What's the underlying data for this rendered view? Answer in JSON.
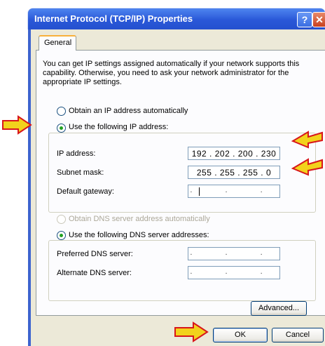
{
  "window": {
    "title": "Internet Protocol (TCP/IP) Properties",
    "help_icon": "question-mark",
    "close_icon": "x"
  },
  "tabs": [
    {
      "label": "General",
      "selected": true
    }
  ],
  "intro_text": "You can get IP settings assigned automatically if your network supports this capability. Otherwise, you need to ask your network administrator for the appropriate IP settings.",
  "ip_settings": {
    "auto_option": {
      "label": "Obtain an IP address automatically",
      "selected": false
    },
    "manual_option": {
      "label": "Use the following IP address:",
      "selected": true
    },
    "fields": [
      {
        "label": "IP address:",
        "value": "192 . 202 . 200 . 230"
      },
      {
        "label": "Subnet mask:",
        "value": "255 . 255 . 255 .   0"
      },
      {
        "label": "Default gateway:",
        "value": "",
        "placeholder_dots": ". . ."
      }
    ]
  },
  "dns_settings": {
    "auto_option": {
      "label": "Obtain DNS server address automatically",
      "selected": false,
      "disabled": true
    },
    "manual_option": {
      "label": "Use the following DNS server addresses:",
      "selected": true
    },
    "fields": [
      {
        "label": "Preferred DNS server:",
        "value": "",
        "placeholder_dots": ". . ."
      },
      {
        "label": "Alternate DNS server:",
        "value": "",
        "placeholder_dots": ". . ."
      }
    ]
  },
  "buttons": {
    "advanced": "Advanced...",
    "ok": "OK",
    "cancel": "Cancel"
  },
  "annotations": {
    "arrow_color": "#f2d21c",
    "arrow_outline": "#d8161b"
  },
  "colors": {
    "titlebar": "#2a58d8",
    "dialog_bg": "#ece9d8",
    "tab_accent": "#f8b03b",
    "radio_fill": "#21a121"
  }
}
